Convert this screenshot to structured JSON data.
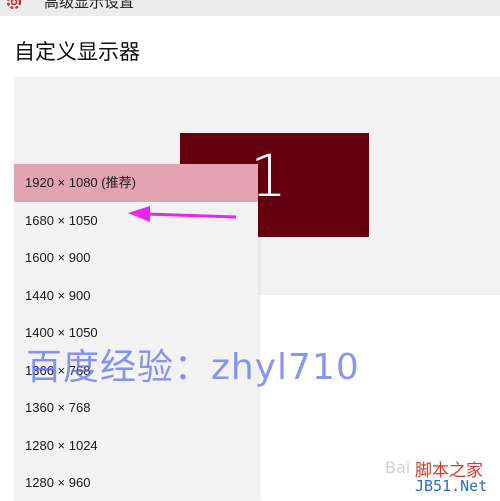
{
  "window": {
    "title": "高级显示设置"
  },
  "page": {
    "title": "自定义显示器"
  },
  "display": {
    "number": "1",
    "color": "#650011"
  },
  "resolution_dropdown": {
    "selected_color": "#e4a3b0",
    "options": [
      {
        "label": "1920 × 1080 (推荐)",
        "selected": true
      },
      {
        "label": "1680 × 1050"
      },
      {
        "label": "1600 × 900"
      },
      {
        "label": "1440 × 900"
      },
      {
        "label": "1400 × 1050"
      },
      {
        "label": "1366 × 768"
      },
      {
        "label": "1360 × 768"
      },
      {
        "label": "1280 × 1024"
      },
      {
        "label": "1280 × 960"
      }
    ]
  },
  "annotation": {
    "arrow_color": "#ee22ee"
  },
  "watermark": {
    "text": "百度经验：zhyl710"
  },
  "site_logo": {
    "line1": "脚本之家",
    "line2": "JB51.Net"
  }
}
